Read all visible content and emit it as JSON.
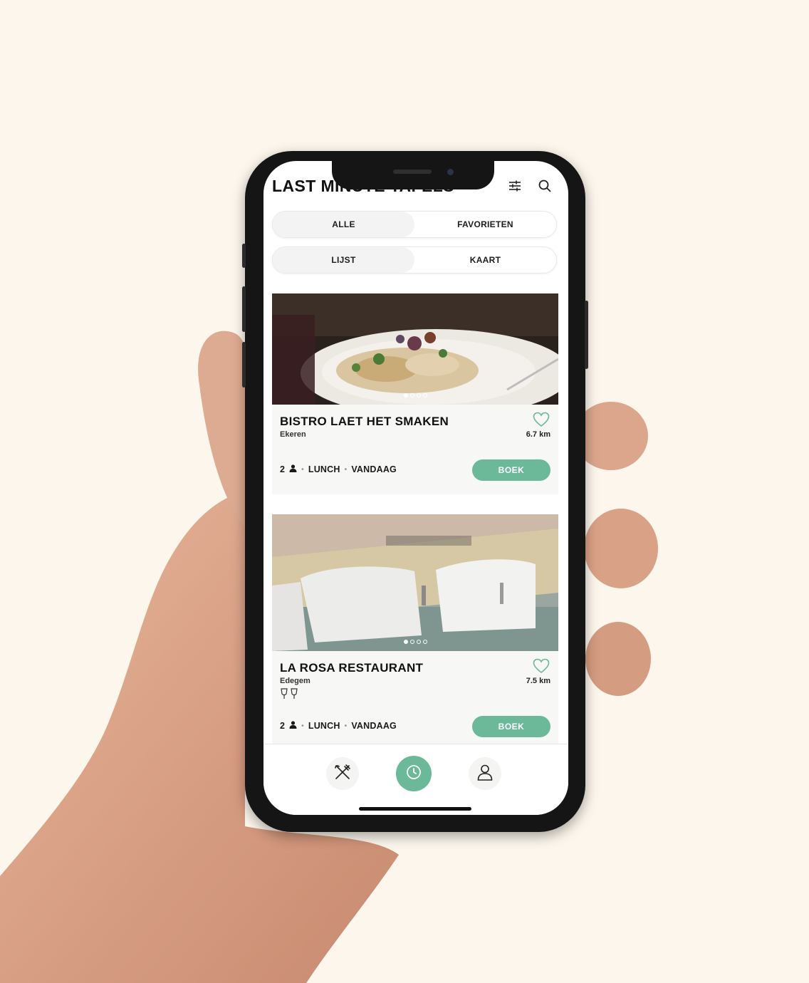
{
  "app": {
    "title": "LAST MINUTE TAFELS"
  },
  "header": {
    "filter_icon": "sliders-icon",
    "search_icon": "search-icon"
  },
  "filters": {
    "scope": {
      "options": [
        "ALLE",
        "FAVORIETEN"
      ],
      "selected": "ALLE"
    },
    "view": {
      "options": [
        "LIJST",
        "KAART"
      ],
      "selected": "LIJST"
    }
  },
  "restaurants": [
    {
      "name": "BISTRO LAET HET SMAKEN",
      "city": "Ekeren",
      "distance": "6.7 km",
      "guests": "2",
      "meal": "LUNCH",
      "day": "VANDAAG",
      "book_label": "BOEK",
      "photo_index": 1,
      "photo_count": 4
    },
    {
      "name": "LA ROSA RESTAURANT",
      "city": "Edegem",
      "distance": "7.5 km",
      "guests": "2",
      "meal": "LUNCH",
      "day": "VANDAAG",
      "book_label": "BOEK",
      "photo_index": 1,
      "photo_count": 4,
      "extra_icon": "wine-glasses-icon"
    }
  ],
  "tabbar": {
    "items": [
      {
        "icon": "cutlery-icon"
      },
      {
        "icon": "clock-icon",
        "active": true
      },
      {
        "icon": "user-icon"
      }
    ]
  },
  "colors": {
    "accent": "#6cb99a",
    "background": "#fcf6ec",
    "card": "#f7f7f5"
  }
}
